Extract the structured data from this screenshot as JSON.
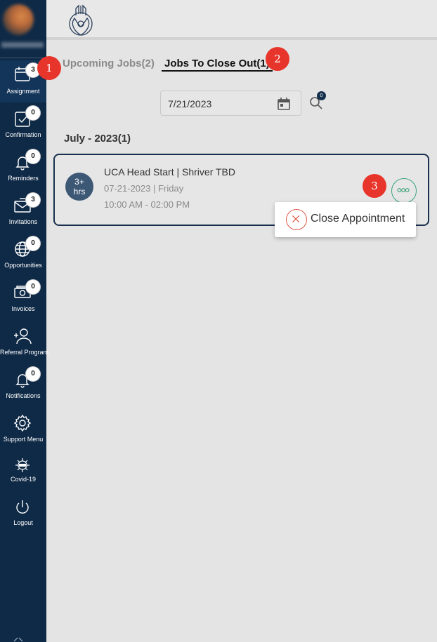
{
  "sidebar": {
    "items": [
      {
        "label": "Assignment",
        "badge": "3",
        "icon": "calendar-icon",
        "active": true
      },
      {
        "label": "Confirmation",
        "badge": "0",
        "icon": "check-square-icon"
      },
      {
        "label": "Reminders",
        "badge": "0",
        "icon": "bell-icon"
      },
      {
        "label": "Invitations",
        "badge": "3",
        "icon": "envelope-icon"
      },
      {
        "label": "Opportunities",
        "badge": "0",
        "icon": "globe-icon"
      },
      {
        "label": "Invoices",
        "badge": "0",
        "icon": "money-icon"
      },
      {
        "label": "Referral Program",
        "icon": "add-user-icon"
      },
      {
        "label": "Notifications",
        "badge": "0",
        "icon": "bell-icon"
      },
      {
        "label": "Support Menu",
        "icon": "gear-icon"
      },
      {
        "label": "Covid-19",
        "icon": "virus-icon"
      },
      {
        "label": "Logout",
        "icon": "power-icon"
      }
    ]
  },
  "tabs": {
    "upcoming": "Upcoming Jobs(2)",
    "closeout": "Jobs To Close Out(1)"
  },
  "date_filter": {
    "value": "7/21/2023",
    "search_badge": "0"
  },
  "month_heading": "July - 2023(1)",
  "job": {
    "duration_line1": "3+",
    "duration_line2": "hrs",
    "title": "UCA Head Start | Shriver TBD",
    "date": "07-21-2023 | Friday",
    "time": "10:00 AM - 02:00 PM"
  },
  "popup": {
    "label": "Close Appointment"
  },
  "markers": [
    "1",
    "2",
    "3"
  ],
  "colors": {
    "sidebar_bg": "#0f2a47",
    "accent_green": "#3aa37a",
    "close_red": "#e0584a",
    "marker_red": "#e8352b"
  }
}
